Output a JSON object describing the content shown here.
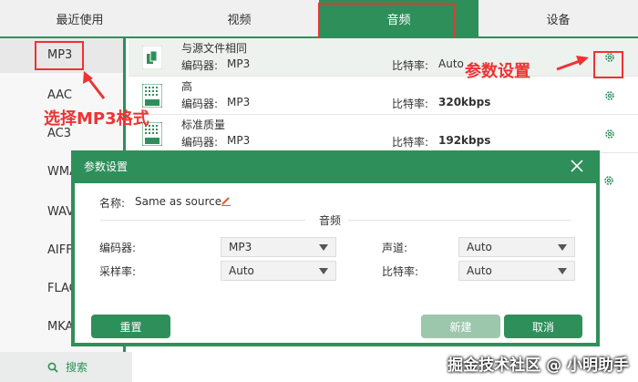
{
  "tabs": [
    {
      "label": "最近使用"
    },
    {
      "label": "视频"
    },
    {
      "label": "音频"
    },
    {
      "label": "设备"
    }
  ],
  "sidebar": {
    "formats": [
      "MP3",
      "AAC",
      "AC3",
      "WMA",
      "WAV",
      "AIFF",
      "FLAC",
      "MKA"
    ],
    "selected": "MP3",
    "search_label": "搜索"
  },
  "presets": [
    {
      "name": "与源文件相同",
      "encoder_label": "编码器:",
      "encoder": "MP3",
      "bitrate_label": "比特率:",
      "bitrate": "Auto"
    },
    {
      "name": "高",
      "encoder_label": "编码器:",
      "encoder": "MP3",
      "bitrate_label": "比特率:",
      "bitrate": "320kbps"
    },
    {
      "name": "标准质量",
      "encoder_label": "编码器:",
      "encoder": "MP3",
      "bitrate_label": "比特率:",
      "bitrate": "192kbps"
    }
  ],
  "annotations": {
    "select_format": "选择MP3格式",
    "param_settings": "参数设置"
  },
  "dialog": {
    "title": "参数设置",
    "name_label": "名称:",
    "name_value": "Same as source",
    "section_label": "音频",
    "encoder_label": "编码器:",
    "encoder_value": "MP3",
    "samplerate_label": "采样率:",
    "samplerate_value": "Auto",
    "channel_label": "声道:",
    "channel_value": "Auto",
    "bitrate_label": "比特率:",
    "bitrate_value": "Auto",
    "reset_button": "重置",
    "new_button": "新建",
    "cancel_button": "取消"
  },
  "watermark": "掘金技术社区 @ 小明助手",
  "colors": {
    "accent": "#2f8f5b",
    "annotation": "#ee3333"
  }
}
